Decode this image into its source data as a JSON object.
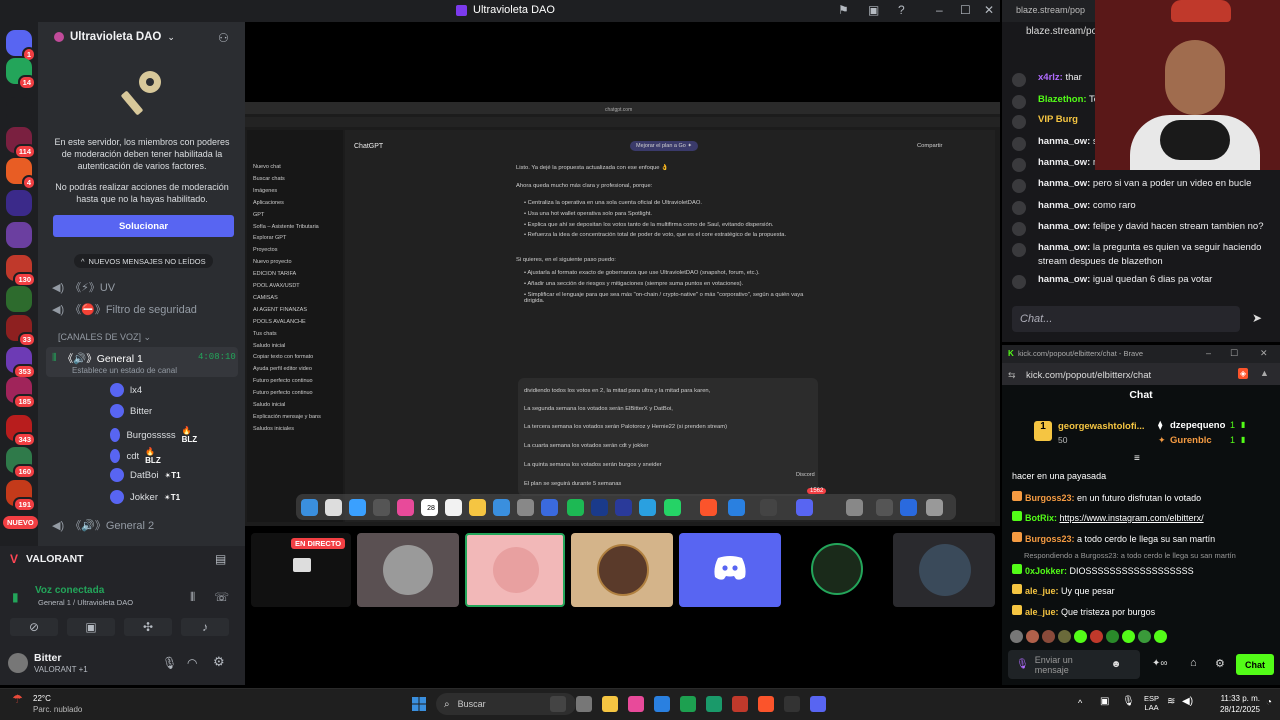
{
  "window": {
    "title": "Ultravioleta DAO"
  },
  "servers": [
    {
      "name": "discord-home",
      "color": "#5865f2",
      "badge": "1"
    },
    {
      "name": "server-green",
      "color": "#23a55a",
      "badge": "14"
    },
    {
      "name": "server-uvdao",
      "color": "#1e1f22",
      "badge": ""
    },
    {
      "name": "server-2",
      "color": "#7a2040",
      "badge": "114"
    },
    {
      "name": "server-3",
      "color": "#e85d24",
      "badge": "4"
    },
    {
      "name": "server-4",
      "color": "#3b2a8a",
      "badge": ""
    },
    {
      "name": "server-5",
      "color": "#6b3fa0",
      "badge": ""
    },
    {
      "name": "server-6",
      "color": "#c0392b",
      "badge": "130"
    },
    {
      "name": "server-7",
      "color": "#2d6b2d",
      "badge": ""
    },
    {
      "name": "server-8",
      "color": "#8e2020",
      "badge": "33"
    },
    {
      "name": "server-9",
      "color": "#6d3bb5",
      "badge": "353"
    },
    {
      "name": "server-10",
      "color": "#a0245a",
      "badge": "185"
    },
    {
      "name": "server-11",
      "color": "#b81d1d",
      "badge": "343"
    },
    {
      "name": "server-12",
      "color": "#2f7a4a",
      "badge": "160"
    },
    {
      "name": "server-13",
      "color": "#c43a1a",
      "badge": "191"
    },
    {
      "name": "server-14",
      "color": "#ffffff",
      "badge": "1K+"
    }
  ],
  "new_label": "NUEVO",
  "guild": {
    "name": "Ultravioleta DAO",
    "notice": "En este servidor, los miembros con poderes de moderación deben tener habilitada la autenticación de varios factores.",
    "notice2": "No podrás realizar acciones de moderación hasta que no la hayas habilitado.",
    "fix_button": "Solucionar",
    "unread_pill": "NUEVOS MENSAJES NO LEÍDOS"
  },
  "channels": [
    {
      "label": "《⚡》UV"
    },
    {
      "label": "《⛔》Filtro de seguridad"
    }
  ],
  "voice_category": "[CANALES DE VOZ]",
  "voice_channel": {
    "label": "《🔊》General 1",
    "timer": "4:08:10",
    "status": "Establece un estado de canal"
  },
  "voice_members": [
    {
      "name": "lx4",
      "tag": "EN DIRECTO",
      "blz": ""
    },
    {
      "name": "Bitter",
      "tag": "",
      "blz": ""
    },
    {
      "name": "Burgosssss",
      "tag": "",
      "blz": "🔥BLZ"
    },
    {
      "name": "cdt",
      "tag": "",
      "blz": "🔥BLZ"
    },
    {
      "name": "DatBoi",
      "tag": "",
      "blz": "✴T1"
    },
    {
      "name": "Jokker",
      "tag": "",
      "blz": "✴T1"
    }
  ],
  "voice_channel2": "《🔊》General 2",
  "activity": {
    "game": "VALORANT"
  },
  "connection": {
    "status": "Voz conectada",
    "location": "General 1 / Ultravioleta DAO"
  },
  "user": {
    "name": "Bitter",
    "activity": "VALORANT +1"
  },
  "screen": {
    "url": "chatgpt.com",
    "app": "ChatGPT",
    "upgrade": "Mejorar el plan a Go ✦",
    "share": "Compartir",
    "sidebar": [
      "Nuevo chat",
      "Buscar chats",
      "Imágenes",
      "Aplicaciones",
      "GPT",
      "Sofía – Asistente Tributaria",
      "Explorar GPT",
      "Proyectos",
      "Nuevo proyecto",
      "EDICION TARIFA",
      "POOL AVAX/USDT",
      "CAMISAS",
      "AI AGENT FINANZAS",
      "POOLS AVALANCHE",
      "Tus chats",
      "Saludo inicial",
      "Copiar texto con formato",
      "Ayuda perfil editor video",
      "Futuro perfecto continuo",
      "Futuro perfecto continuo",
      "Saludo inicial",
      "Explicación mensaje y bans",
      "Saludos iniciales"
    ],
    "msgs": [
      "Listo. Ya dejé la propuesta actualizada con ese enfoque 👌",
      "Ahora queda mucho más clara y profesional, porque:",
      "• Centraliza la operativa en una sola cuenta oficial de UltravioletDAO.",
      "• Usa una hot wallet operativa solo para Spotlight.",
      "• Explica que ahí se depositan los votos tanto de la multifirma como de Saul, evitando dispersión.",
      "• Refuerza la idea de concentración total de poder de voto, que es el core estratégico de la propuesta.",
      "Si quieres, en el siguiente paso puedo:",
      "• Ajustarla al formato exacto de gobernanza que use UltravioletDAO (snapshot, forum, etc.).",
      "• Añadir una sección de riesgos y mitigaciones (siempre suma puntos en votaciones).",
      "• Simplificar el lenguaje para que sea más \"on-chain / crypto-native\" o más \"corporativo\", según a quién vaya dirigida."
    ],
    "doc": [
      "dividiendo todos los votos en 2, la mitad para ultra y la mitad para karen,",
      "La segunda semana los votados serán ElBitterX y DatBoi,",
      "La tercera semana los votados serán Palotoroz y Hernie22 (si prenden stream)",
      "La cuarta semana los votados serán cdt y jokker",
      "La quinta semana los votados serán burgos y sneider",
      "El plan se seguirá durante 5 semanas"
    ],
    "dock_badge": "1562",
    "discord_tip": "Discord",
    "calendar": "28"
  },
  "tiles": [
    {
      "label": "EN DIRECTO"
    }
  ],
  "kick1": {
    "url": "blaze.stream/popout/...",
    "url2": "blaze.stream/pop",
    "messages": [
      {
        "user": "x4rlz:",
        "text": "thar",
        "color": "#b06bff"
      },
      {
        "user": "Blazethon:",
        "text": "To",
        "color": "#53fc18"
      },
      {
        "user": "VIP Burg",
        "text": "",
        "color": "#f5c542"
      },
      {
        "user": "hanma_ow:",
        "text": "s",
        "color": "#efeff1"
      },
      {
        "user": "hanma_ow:",
        "text": "n",
        "color": "#efeff1"
      },
      {
        "user": "hanma_ow:",
        "text": "pero si van a poder un video en bucle",
        "color": "#efeff1"
      },
      {
        "user": "hanma_ow:",
        "text": "como raro",
        "color": "#efeff1"
      },
      {
        "user": "hanma_ow:",
        "text": "felipe y david hacen stream tambien no?",
        "color": "#efeff1"
      },
      {
        "user": "hanma_ow:",
        "text": "la pregunta es quien va seguir haciendo",
        "color": "#efeff1"
      },
      {
        "user": "",
        "text": "stream despues de blazethon",
        "color": "#efeff1"
      },
      {
        "user": "hanma_ow:",
        "text": "igual quedan 6 dias pa votar",
        "color": "#efeff1"
      }
    ],
    "input_placeholder": "Chat..."
  },
  "kick2": {
    "tab": "kick.com/popout/elbitterx/chat - Brave",
    "url": "kick.com/popout/elbitterx/chat",
    "header": "Chat",
    "gifter1": "georgewashtolofi...",
    "gifter1_count": "50",
    "gifter2": "dzepequeno",
    "gifter2_count": "1",
    "gifter3": "Gurenblc",
    "gifter3_count": "1",
    "messages": [
      {
        "user": "",
        "text": "hacer en una payasada",
        "color": "#fff"
      },
      {
        "user": "Burgoss23:",
        "text": "en un futuro disfrutan lo votado",
        "color": "#f59b42"
      },
      {
        "user": "BotRix:",
        "text": "https://www.instagram.com/elbitterx/",
        "color": "#53fc18"
      },
      {
        "user": "Burgoss23:",
        "text": "a todo cerdo le llega su san martín",
        "color": "#f59b42"
      },
      {
        "user": "",
        "text": "Respondiendo a Burgoss23: a todo cerdo le llega su san martín",
        "color": "#999"
      },
      {
        "user": "0xJokker:",
        "text": "DIOSSSSSSSSSSSSSSSSSS",
        "color": "#53fc18"
      },
      {
        "user": "ale_jue:",
        "text": "Uy que pesar",
        "color": "#f5c542"
      },
      {
        "user": "ale_jue:",
        "text": "Que tristeza por burgos",
        "color": "#f5c542"
      }
    ],
    "send_placeholder": "Enviar un mensaje",
    "chat_button": "Chat"
  },
  "taskbar": {
    "weather_temp": "22°C",
    "weather_desc": "Parc. nublado",
    "search": "Buscar",
    "lang1": "ESP",
    "lang2": "LAA",
    "time": "11:33 p. m.",
    "date": "28/12/2025"
  }
}
